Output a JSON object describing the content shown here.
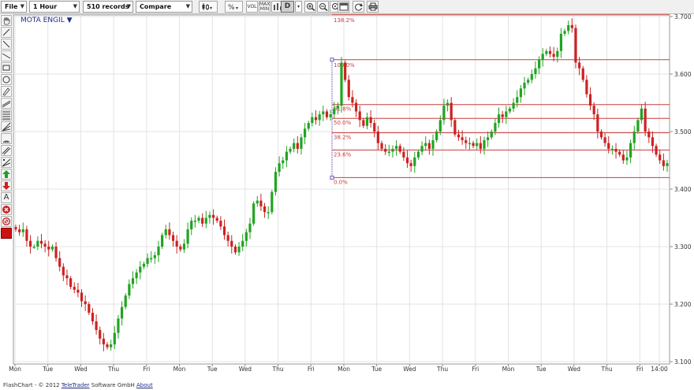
{
  "toolbar": {
    "file_label": "File",
    "interval_label": "1 Hour",
    "records_label": "510 records",
    "compare_label": "Compare",
    "volume_btn": "VOL",
    "minmax_btn": "MAX MIN",
    "d_btn": "D"
  },
  "chart_title": "MOTA ENGIL ▼",
  "footer": {
    "prefix": "FlashChart - © 2012",
    "telepart": "TeleTrader",
    "middle": " Software GmbH ",
    "about": "About"
  },
  "colors": {
    "up": "#22a322",
    "down": "#cc2222",
    "grid": "#e3e3e3",
    "fib": "#c83c3c"
  },
  "chart_data": {
    "type": "candlestick",
    "ylim": [
      3.1,
      3.7
    ],
    "y_ticks": [
      "3.700",
      "3.600",
      "3.500",
      "3.400",
      "3.300",
      "3.200",
      "3.100"
    ],
    "x_ticks": [
      "Mon",
      "Tue",
      "Wed",
      "Thu",
      "Fri",
      "Mon",
      "Tue",
      "Wed",
      "Thu",
      "Fri",
      "Mon",
      "Tue",
      "Wed",
      "Thu",
      "Fri",
      "Mon",
      "Tue",
      "Wed",
      "Thu",
      "Fri",
      "14:00"
    ],
    "fibonacci": {
      "low": 3.42,
      "high": 3.625,
      "levels": [
        {
          "label": "138.2%",
          "value": 3.703
        },
        {
          "label": "100.0%",
          "value": 3.625
        },
        {
          "label": "61.8%",
          "value": 3.547
        },
        {
          "label": "50.0%",
          "value": 3.523
        },
        {
          "label": "38.2%",
          "value": 3.498
        },
        {
          "label": "23.6%",
          "value": 3.468
        },
        {
          "label": "0.0%",
          "value": 3.42
        }
      ]
    },
    "closes": [
      3.33,
      3.325,
      3.33,
      3.31,
      3.3,
      3.3,
      3.31,
      3.305,
      3.3,
      3.295,
      3.3,
      3.28,
      3.265,
      3.25,
      3.245,
      3.23,
      3.225,
      3.22,
      3.205,
      3.2,
      3.185,
      3.17,
      3.155,
      3.14,
      3.13,
      3.125,
      3.13,
      3.15,
      3.175,
      3.195,
      3.215,
      3.235,
      3.245,
      3.255,
      3.265,
      3.27,
      3.28,
      3.28,
      3.285,
      3.3,
      3.32,
      3.33,
      3.32,
      3.31,
      3.3,
      3.295,
      3.305,
      3.33,
      3.345,
      3.345,
      3.35,
      3.34,
      3.35,
      3.355,
      3.35,
      3.345,
      3.335,
      3.32,
      3.31,
      3.3,
      3.29,
      3.3,
      3.31,
      3.325,
      3.34,
      3.375,
      3.38,
      3.37,
      3.36,
      3.36,
      3.395,
      3.43,
      3.445,
      3.45,
      3.465,
      3.47,
      3.48,
      3.47,
      3.49,
      3.505,
      3.515,
      3.525,
      3.52,
      3.53,
      3.535,
      3.525,
      3.53,
      3.54,
      3.545,
      3.62,
      3.59,
      3.56,
      3.55,
      3.535,
      3.52,
      3.51,
      3.525,
      3.515,
      3.5,
      3.48,
      3.47,
      3.465,
      3.465,
      3.47,
      3.475,
      3.465,
      3.455,
      3.445,
      3.44,
      3.455,
      3.465,
      3.475,
      3.48,
      3.47,
      3.485,
      3.5,
      3.52,
      3.545,
      3.55,
      3.52,
      3.495,
      3.49,
      3.485,
      3.48,
      3.48,
      3.475,
      3.48,
      3.47,
      3.485,
      3.49,
      3.5,
      3.515,
      3.53,
      3.525,
      3.535,
      3.54,
      3.55,
      3.56,
      3.575,
      3.585,
      3.59,
      3.6,
      3.61,
      3.625,
      3.635,
      3.64,
      3.635,
      3.63,
      3.64,
      3.67,
      3.675,
      3.685,
      3.68,
      3.62,
      3.61,
      3.59,
      3.565,
      3.545,
      3.53,
      3.5,
      3.49,
      3.48,
      3.47,
      3.47,
      3.465,
      3.46,
      3.45,
      3.455,
      3.48,
      3.5,
      3.52,
      3.54,
      3.5,
      3.49,
      3.475,
      3.46,
      3.45,
      3.44,
      3.445
    ]
  }
}
